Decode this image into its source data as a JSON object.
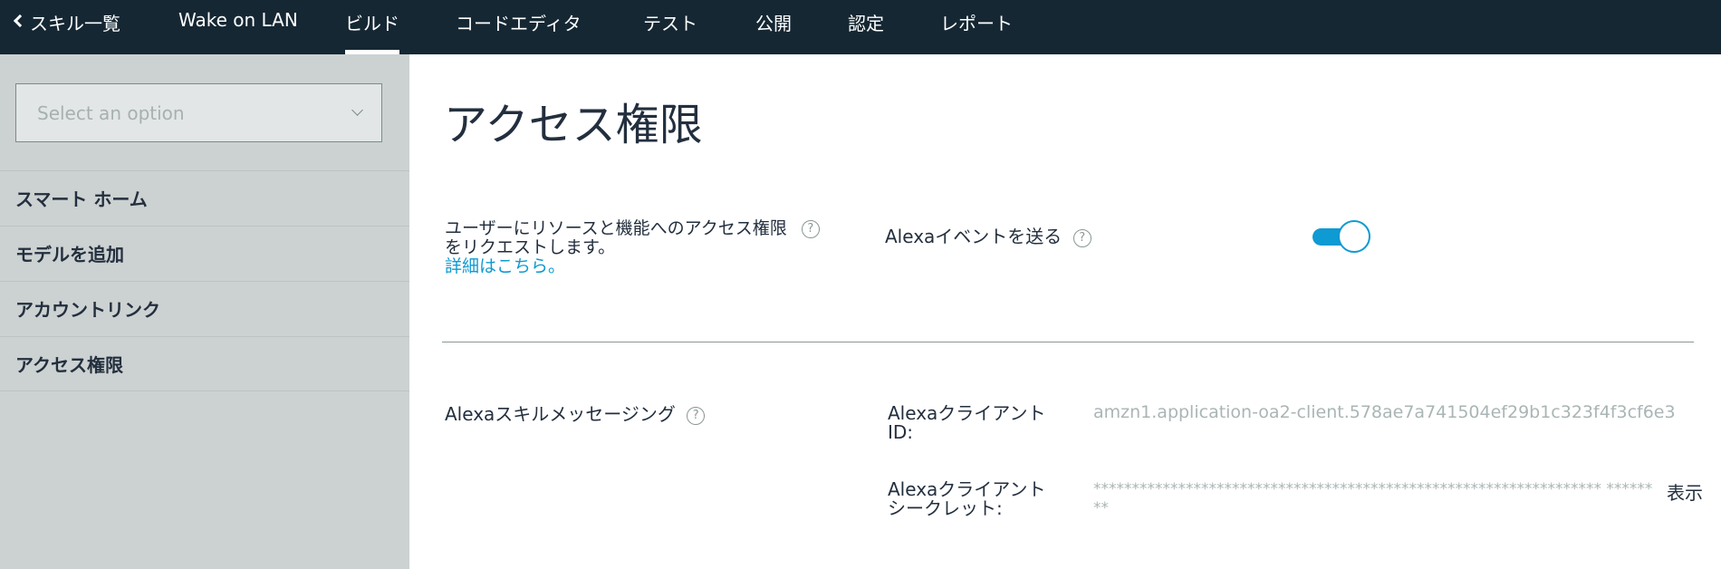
{
  "topnav": {
    "back_label": "スキル一覧",
    "items": [
      {
        "label": "Wake on LAN"
      },
      {
        "label": "ビルド"
      },
      {
        "label": "コードエディタ"
      },
      {
        "label": "テスト"
      },
      {
        "label": "公開"
      },
      {
        "label": "認定"
      },
      {
        "label": "レポート"
      }
    ],
    "active": "ビルド",
    "background_color": "#152733"
  },
  "sidebar": {
    "select_placeholder": "Select an option",
    "items": [
      {
        "label": "スマート ホーム"
      },
      {
        "label": "モデルを追加"
      },
      {
        "label": "アカウントリンク"
      },
      {
        "label": "アクセス権限"
      }
    ],
    "background_color": "#ccd1d1"
  },
  "main": {
    "title": "アクセス権限",
    "description_line1": "ユーザーにリソースと機能へのアクセス権限",
    "description_line2": "をリクエストします。",
    "learn_more_link": "詳細はこちら。",
    "help_symbol": "?",
    "events": {
      "label": "Alexaイベントを送る",
      "toggle_on": true
    },
    "messaging": {
      "label": "Alexaスキルメッセージング",
      "client_id_label_line1": "Alexaクライアント",
      "client_id_label_line2": "ID:",
      "client_id_value": "amzn1.application-oa2-client.578ae7a741504ef29b1c323f4f3cf6e3",
      "client_secret_label_line1": "Alexaクライアント",
      "client_secret_label_line2": "シークレット:",
      "client_secret_value": "****************************************************************** ********",
      "show_link": "表示"
    },
    "accent_color": "#0e9ad2"
  }
}
